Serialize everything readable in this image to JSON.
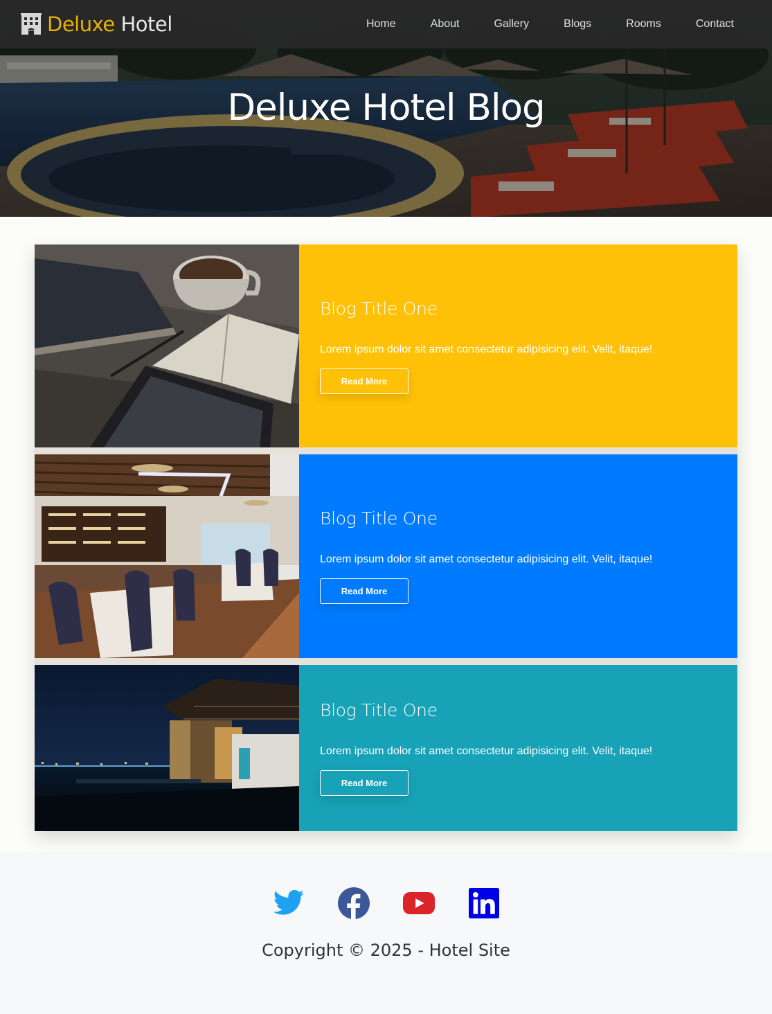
{
  "brand": {
    "accent": "Deluxe",
    "rest": "Hotel",
    "icon": "hotel-building-icon"
  },
  "nav": {
    "items": [
      "Home",
      "About",
      "Gallery",
      "Blogs",
      "Rooms",
      "Contact"
    ]
  },
  "hero": {
    "title": "Deluxe Hotel Blog"
  },
  "blogs": [
    {
      "title": "Blog Title One",
      "text": "Lorem ipsum dolor sit amet consectetur adipisicing elit. Velit, itaque!",
      "button": "Read More",
      "color": "#ffc107",
      "image": "coffee-notebook-tablet-photo"
    },
    {
      "title": "Blog Title One",
      "text": "Lorem ipsum dolor sit amet consectetur adipisicing elit. Velit, itaque!",
      "button": "Read More",
      "color": "#007bff",
      "image": "hotel-restaurant-dining-photo"
    },
    {
      "title": "Blog Title One",
      "text": "Lorem ipsum dolor sit amet consectetur adipisicing elit. Velit, itaque!",
      "button": "Read More",
      "color": "#17a2b8",
      "image": "night-waterfront-pavilion-photo"
    }
  ],
  "footer": {
    "social": [
      "twitter-icon",
      "facebook-icon",
      "youtube-icon",
      "linkedin-icon"
    ],
    "copyright": "Copyright © 2025 - Hotel Site"
  },
  "colors": {
    "brand_accent": "#e8b100",
    "twitter": "#1da1f2",
    "facebook": "#3b5998",
    "youtube": "#d9252a",
    "linkedin": "#0000e8"
  }
}
